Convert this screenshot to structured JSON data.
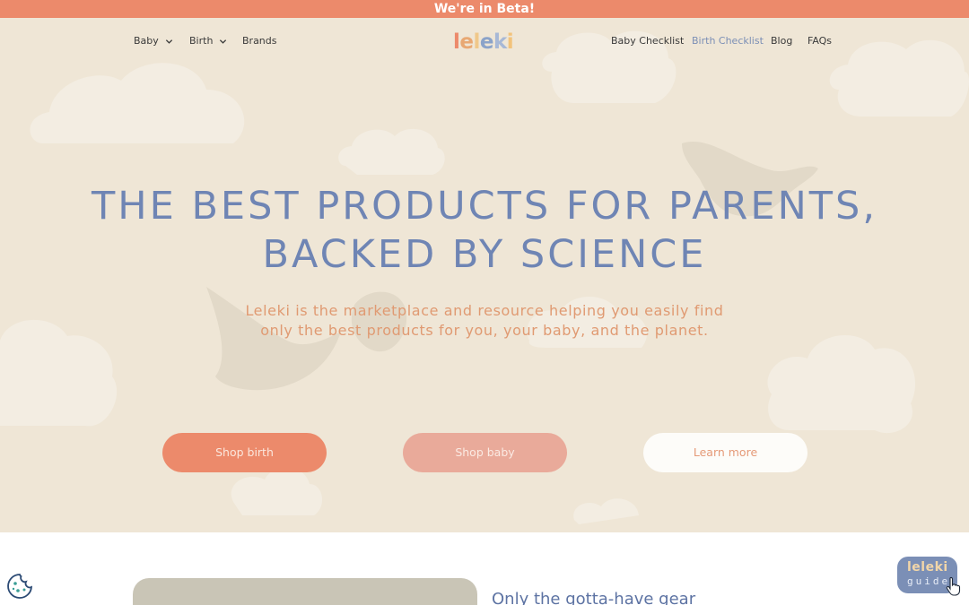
{
  "beta_banner": "We're in Beta!",
  "nav": {
    "left": [
      {
        "label": "Baby",
        "icon": "chevron-down-icon"
      },
      {
        "label": "Birth",
        "icon": "chevron-down-icon"
      },
      {
        "label": "Brands"
      }
    ],
    "logo_letters": [
      "l",
      "e",
      "l",
      "e",
      "k",
      "i"
    ],
    "logo_colors": [
      "#ec8a6b",
      "#e8a873",
      "#f0c88a",
      "#8ba3c9",
      "#a7b8d6",
      "#f2c37b"
    ],
    "right": [
      {
        "label": "Baby Checklist"
      },
      {
        "label": "Birth Checklist",
        "active": true
      },
      {
        "label": "Blog"
      },
      {
        "label": "FAQs"
      }
    ]
  },
  "hero": {
    "headline_line1": "THE BEST PRODUCTS FOR PARENTS,",
    "headline_line2": "BACKED BY SCIENCE",
    "sub_line1": "Leleki is the marketplace and resource helping you easily find",
    "sub_line2": "only the best products for you, your baby, and the planet.",
    "buttons": {
      "shop_birth": "Shop birth",
      "shop_baby": "Shop baby",
      "learn_more": "Learn more"
    }
  },
  "lower": {
    "heading": "Only the gotta-have gear"
  },
  "guide_badge": {
    "line1": "leleki",
    "line2": "guide"
  },
  "colors": {
    "accent": "#ec8a6b",
    "hero_bg": "#efe6d6",
    "headline": "#6f85b4",
    "subtext": "#e09a72",
    "badge": "#7b8fb6"
  }
}
